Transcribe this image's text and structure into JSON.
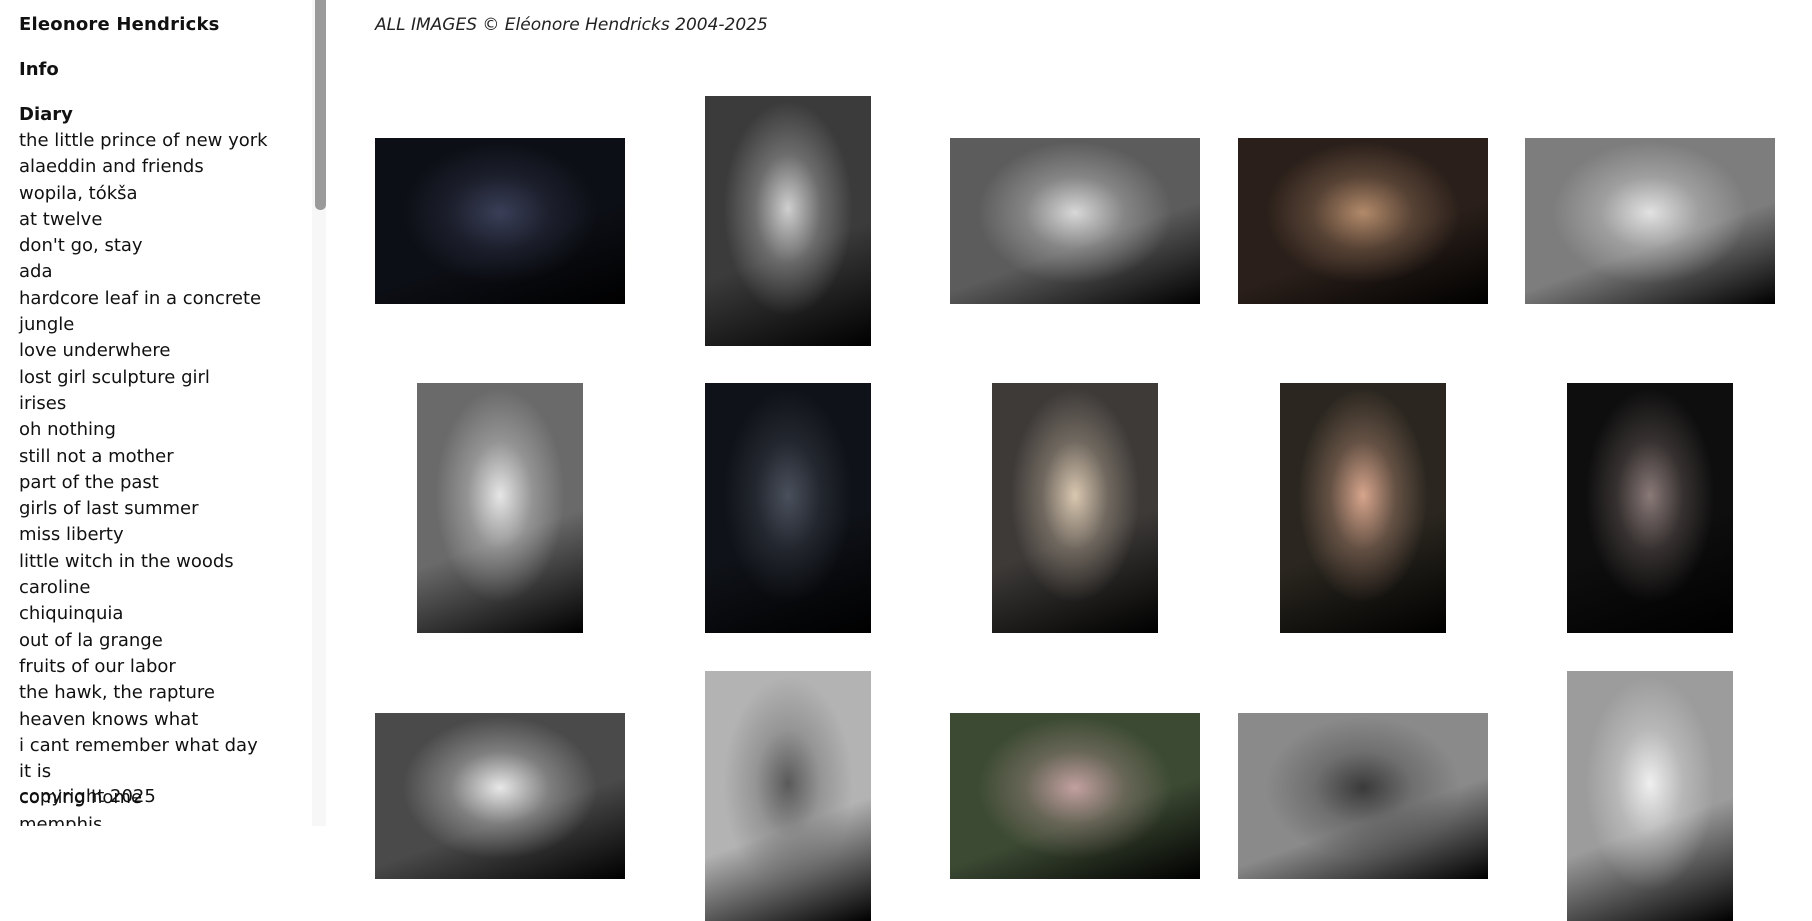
{
  "site": {
    "title": "Eleonore Hendricks",
    "info_label": "Info",
    "diary_label": "Diary",
    "copyright": "copyright 2025",
    "rights_notice": "ALL IMAGES © Eléonore Hendricks 2004-2025"
  },
  "diary_entries": [
    "the little prince of new york",
    "alaeddin and friends",
    "wopila, tókša",
    "at twelve",
    "don't go, stay",
    "ada",
    "hardcore leaf in a concrete jungle",
    "love underwhere",
    "lost girl sculpture girl",
    "irises",
    "oh nothing",
    "still not a mother",
    "part of the past",
    "girls of last summer",
    "miss liberty",
    "little witch in the woods",
    "caroline",
    "chiquinquia",
    "out of la grange",
    "fruits of our labor",
    "the hawk, the rapture",
    "heaven knows what",
    "i cant remember what day it is",
    "coming home",
    "memphis"
  ],
  "colors": {
    "page_bg": "#ffffff",
    "text": "#111111",
    "scroll_thumb": "#9a9a9a"
  },
  "gallery": [
    {
      "name": "photo-night-street-boy",
      "bg": "#0d0f16",
      "accent": "#3a3f58"
    },
    {
      "name": "photo-boy-leaning-window",
      "bg": "#3b3b3b",
      "accent": "#cfcfcf"
    },
    {
      "name": "photo-bw-room-man",
      "bg": "#5c5c5c",
      "accent": "#d8d8d8"
    },
    {
      "name": "photo-stoop-group-night",
      "bg": "#2a1f1a",
      "accent": "#b28a6a"
    },
    {
      "name": "photo-bw-boy-apartment",
      "bg": "#7d7d7d",
      "accent": "#e2e2e2"
    },
    {
      "name": "photo-bw-shirtless-boy",
      "bg": "#6a6a6a",
      "accent": "#e6e6e6"
    },
    {
      "name": "photo-night-girl-walking",
      "bg": "#0f1218",
      "accent": "#4a505c"
    },
    {
      "name": "photo-girl-car-window",
      "bg": "#3d3a38",
      "accent": "#d9c7b0"
    },
    {
      "name": "photo-woman-street-night",
      "bg": "#2b2720",
      "accent": "#d7a58c"
    },
    {
      "name": "photo-dark-silhouette",
      "bg": "#0e0e0e",
      "accent": "#8a7a78"
    },
    {
      "name": "photo-bw-boy-car",
      "bg": "#4a4a4a",
      "accent": "#e8e8e8"
    },
    {
      "name": "photo-bw-girl-wall",
      "bg": "#b3b3b3",
      "accent": "#5a5a5a"
    },
    {
      "name": "photo-kids-car-window",
      "bg": "#3c4a33",
      "accent": "#c2a0a0"
    },
    {
      "name": "photo-bw-kids-house",
      "bg": "#8a8a8a",
      "accent": "#3a3a3a"
    },
    {
      "name": "photo-bw-boy-hoodie",
      "bg": "#9c9c9c",
      "accent": "#efefef"
    }
  ]
}
